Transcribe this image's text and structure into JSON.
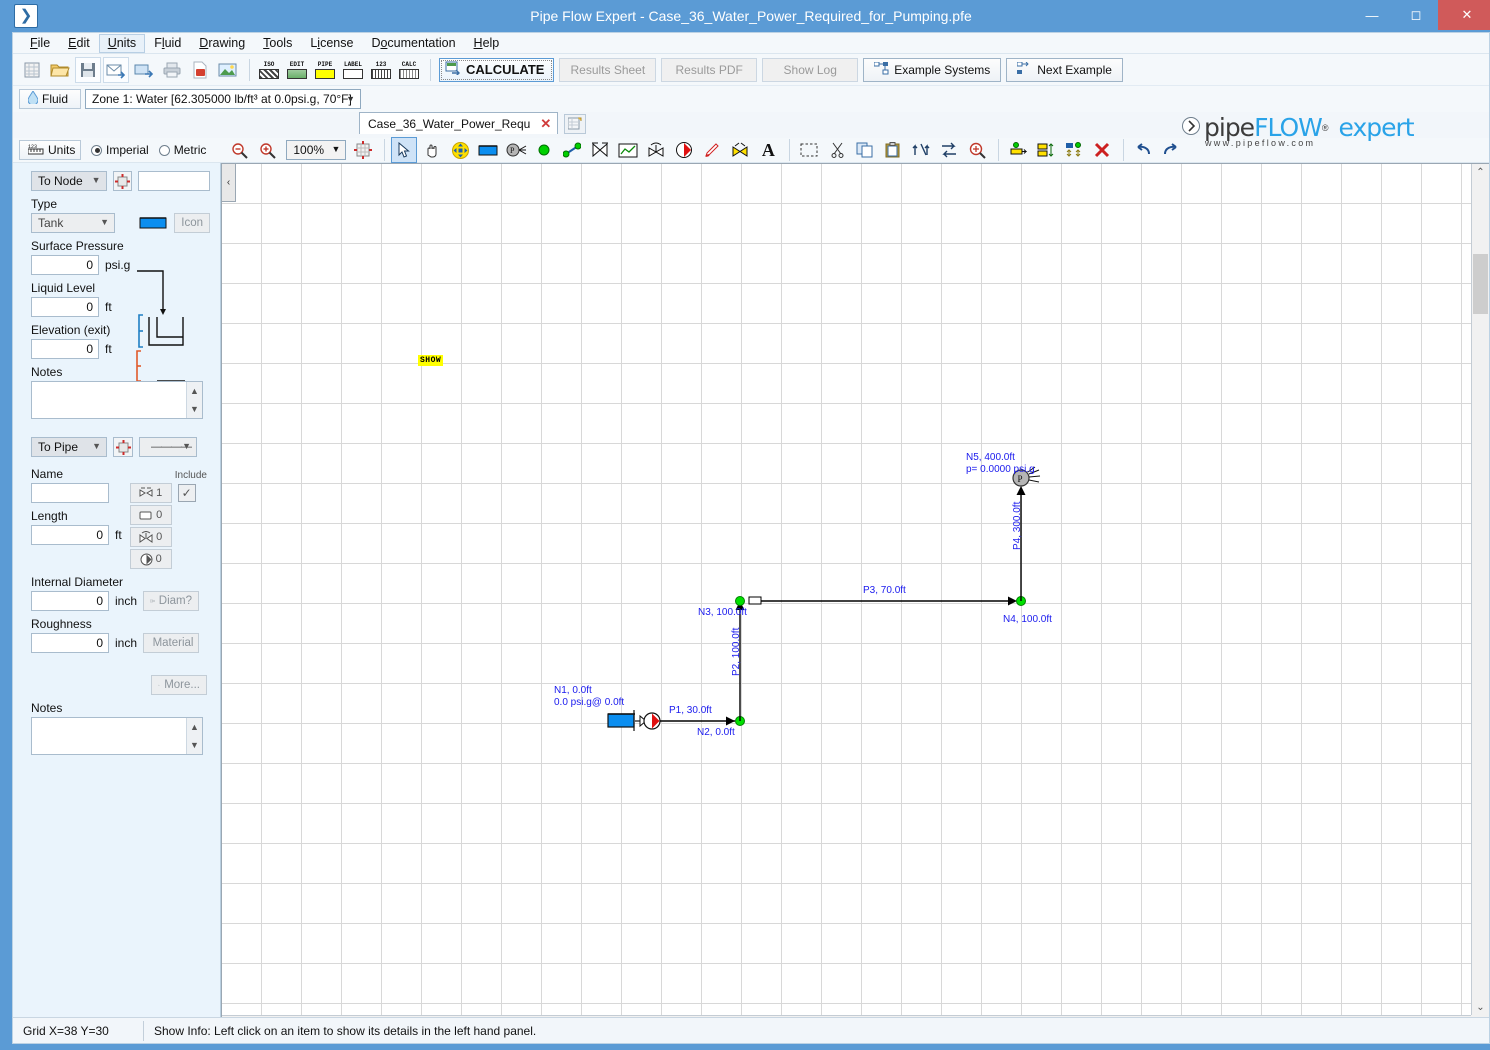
{
  "window": {
    "title": "Pipe Flow Expert - Case_36_Water_Power_Required_for_Pumping.pfe",
    "app_icon": "chevron-right-icon",
    "minimize": "—",
    "maximize": "☐",
    "close": "✕"
  },
  "menubar": {
    "items": [
      {
        "label": "File",
        "active": false
      },
      {
        "label": "Edit",
        "active": false
      },
      {
        "label": "Units",
        "active": true
      },
      {
        "label": "Fluid",
        "active": false
      },
      {
        "label": "Drawing",
        "active": false
      },
      {
        "label": "Tools",
        "active": false
      },
      {
        "label": "License",
        "active": false
      },
      {
        "label": "Documentation",
        "active": false
      },
      {
        "label": "Help",
        "active": false
      }
    ]
  },
  "toolbar_main": {
    "file_icons": [
      "new-icon",
      "open-icon",
      "save-icon",
      "email-icon",
      "export-icon",
      "print-icon",
      "pdf-icon",
      "image-icon"
    ],
    "label_icons": [
      {
        "caption": "ISO",
        "name": "isometric-icon"
      },
      {
        "caption": "EDIT",
        "name": "edit-grid-icon"
      },
      {
        "caption": "PIPE",
        "name": "pipe-icon"
      },
      {
        "caption": "LABEL",
        "name": "label-icon"
      },
      {
        "caption": "123",
        "name": "numbers-icon"
      },
      {
        "caption": "CALC",
        "name": "calc-icon"
      }
    ],
    "calculate_label": "CALCULATE",
    "buttons": [
      {
        "label": "Results Sheet",
        "enabled": false,
        "icon": ""
      },
      {
        "label": "Results PDF",
        "enabled": false,
        "icon": ""
      },
      {
        "label": "Show Log",
        "enabled": false,
        "icon": ""
      },
      {
        "label": "Example Systems",
        "enabled": true,
        "icon": "network-icon"
      },
      {
        "label": "Next Example",
        "enabled": true,
        "icon": "network-next-icon"
      }
    ]
  },
  "fluid_bar": {
    "fluid_button": "Fluid",
    "fluid_icon": "droplet-icon",
    "zone_value": "Zone 1: Water [62.305000 lb/ft³ at 0.0psi.g, 70°F]"
  },
  "tabs": {
    "document_tab": "Case_36_Water_Power_Requ",
    "close_glyph": "✕",
    "new_tab_icon": "new-sheet-icon"
  },
  "units_bar": {
    "units_button": "Units",
    "units_icon": "ruler-icon",
    "imperial": "Imperial",
    "metric": "Metric",
    "selected_system": "Imperial",
    "zoom_out_icon": "zoom-out-icon",
    "zoom_in_icon": "zoom-in-icon",
    "zoom_value": "100%",
    "grid_icon": "grid-snap-icon",
    "draw_tools": [
      "select-arrow-icon",
      "pan-hand-icon",
      "move-icon",
      "tank-icon",
      "discharge-icon",
      "node-icon",
      "pipe-icon",
      "flow-meter-icon",
      "chart-icon",
      "valve-icon",
      "pump-icon",
      "pencil-icon",
      "component-icon",
      "text-icon"
    ],
    "edit_tools": [
      "marquee-select-icon",
      "cut-icon",
      "copy-icon",
      "paste-icon",
      "flip-vertical-icon",
      "flip-horizontal-icon",
      "zoom-region-icon",
      "align-left-icon",
      "align-center-icon",
      "distribute-icon",
      "delete-icon",
      "undo-icon",
      "redo-icon"
    ]
  },
  "logo": {
    "brand_pipe": "pipe",
    "brand_flow": "FLOW",
    "registered": "®",
    "product": "expert",
    "url": "www.pipeflow.com"
  },
  "left_panel": {
    "node_section": {
      "mode_select": "To Node",
      "mode_options": [
        "To Node"
      ],
      "pick_icon": "pick-target-icon",
      "name_value": "",
      "type_label": "Type",
      "type_value": "Tank",
      "tank_preview_icon": "tank-icon",
      "icon_button": "Icon",
      "surface_pressure_label": "Surface Pressure",
      "surface_pressure_value": "0",
      "surface_pressure_unit": "psi.g",
      "liquid_level_label": "Liquid Level",
      "liquid_level_value": "0",
      "liquid_level_unit": "ft",
      "elevation_label": "Elevation (exit)",
      "elevation_value": "0",
      "elevation_unit": "ft",
      "notes_label": "Notes",
      "notes_value": ""
    },
    "pipe_section": {
      "mode_select": "To Pipe",
      "pick_icon": "pick-target-icon",
      "linestyle_value": "————",
      "name_label": "Name",
      "name_value": "",
      "include_label": "Include",
      "include_checked": true,
      "counters": [
        {
          "icon": "fittings-icon",
          "count": "1"
        },
        {
          "icon": "component-icon",
          "count": "0"
        },
        {
          "icon": "valve-icon",
          "count": "0"
        },
        {
          "icon": "pump-icon",
          "count": "0"
        }
      ],
      "length_label": "Length",
      "length_value": "0",
      "length_unit": "ft",
      "internal_diameter_label": "Internal Diameter",
      "internal_diameter_value": "0",
      "internal_diameter_unit": "inch",
      "diam_button": "Diam?",
      "roughness_label": "Roughness",
      "roughness_value": "0",
      "roughness_unit": "inch",
      "material_button": "Material",
      "more_button": "More...",
      "notes_label": "Notes",
      "notes_value": ""
    }
  },
  "canvas": {
    "collapse_glyph": "‹",
    "show_marker": "SHOW",
    "scroll_up_glyph": "⌃",
    "scroll_down_glyph": "⌄",
    "scroll_left_glyph": "‹",
    "scroll_right_glyph": "›"
  },
  "diagram": {
    "nodes": [
      {
        "id": "N1",
        "label": "N1, 0.0ft",
        "sublabel": "0.0 psi.g@ 0.0ft",
        "type": "tank"
      },
      {
        "id": "N2",
        "label": "N2, 0.0ft",
        "type": "junction"
      },
      {
        "id": "N3",
        "label": "N3, 100.0ft",
        "type": "junction"
      },
      {
        "id": "N4",
        "label": "N4, 100.0ft",
        "type": "junction"
      },
      {
        "id": "N5",
        "label": "N5, 400.0ft",
        "sublabel": "p= 0.0000 psi.g",
        "type": "discharge"
      }
    ],
    "pipes": [
      {
        "id": "P1",
        "label": "P1, 30.0ft",
        "from": "N1",
        "to": "N2"
      },
      {
        "id": "P2",
        "label": "P2, 100.0ft",
        "from": "N2",
        "to": "N3"
      },
      {
        "id": "P3",
        "label": "P3, 70.0ft",
        "from": "N3",
        "to": "N4"
      },
      {
        "id": "P4",
        "label": "P4, 300.0ft",
        "from": "N4",
        "to": "N5"
      }
    ],
    "pump_label": "pump-icon",
    "discharge_label": "spray-discharge-icon"
  },
  "statusbar": {
    "grid_text": "Grid  X=38  Y=30",
    "info_text": "Show Info: Left click on an item to show its details in the left hand panel."
  },
  "colors": {
    "accent": "#5b9bd5",
    "label_blue": "#1a1aee",
    "node_green": "#00e000",
    "panel_bg": "#eaf4fc",
    "close_red": "#d05a5a"
  }
}
